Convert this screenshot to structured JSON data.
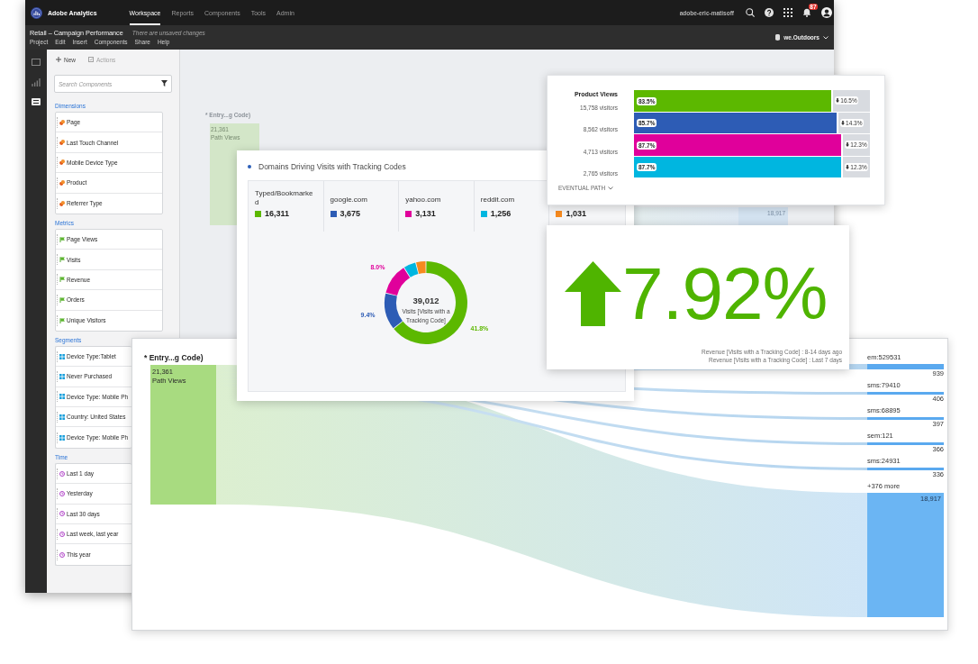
{
  "app": {
    "name": "Adobe Analytics",
    "nav": [
      {
        "label": "Workspace",
        "selected": true
      },
      {
        "label": "Reports",
        "selected": false
      },
      {
        "label": "Components",
        "selected": false
      },
      {
        "label": "Tools",
        "selected": false
      },
      {
        "label": "Admin",
        "selected": false
      }
    ],
    "user": "adobe-eric-matisoff",
    "notifications": "87"
  },
  "project": {
    "title": "Retail – Campaign Performance",
    "status": "There are unsaved changes",
    "menu": [
      "Project",
      "Edit",
      "Insert",
      "Components",
      "Share",
      "Help"
    ],
    "report_suite": "we.Outdoors"
  },
  "rail": [
    {
      "kind": "panels",
      "selected": false
    },
    {
      "kind": "visualizations",
      "selected": false
    },
    {
      "kind": "components",
      "selected": true
    }
  ],
  "sidebar": {
    "actions": [
      {
        "kind": "new",
        "label": "New",
        "disabled": false
      },
      {
        "kind": "actions",
        "label": "Actions",
        "disabled": true
      }
    ],
    "search": {
      "placeholder": "Search Components"
    },
    "sections": [
      {
        "title": "Dimensions",
        "kind": "dimension",
        "items": [
          "Page",
          "Last Touch Channel",
          "Mobile Device Type",
          "Product",
          "Referrer Type"
        ]
      },
      {
        "title": "Metrics",
        "kind": "metric",
        "items": [
          "Page Views",
          "Visits",
          "Revenue",
          "Orders",
          "Unique Visitors"
        ]
      },
      {
        "title": "Segments",
        "kind": "segment",
        "items": [
          "Device Type:Tablet",
          "Never Purchased",
          "Device Type: Mobile Ph",
          "Country: United States",
          "Device Type: Mobile Ph"
        ]
      },
      {
        "title": "Time",
        "kind": "time",
        "items": [
          "Last 1 day",
          "Yesterday",
          "Last 30 days",
          "Last week, last year",
          "This year"
        ]
      }
    ]
  },
  "background_panel": {
    "title": "* Entry...g Code)",
    "value": "21,361",
    "label": "Path Views",
    "node_value": "18,917"
  },
  "product_views": {
    "steps": [
      {
        "name": "Product Views",
        "visitors": "15,758 visitors",
        "percent": "83.5%",
        "drop": "16.5%",
        "color": "#5cb800",
        "level": 0.835
      },
      {
        "visitors": "8,562 visitors",
        "percent": "85.7%",
        "drop": "14.3%",
        "color": "#2d5cb5",
        "level": 0.857
      },
      {
        "visitors": "4,713 visitors",
        "percent": "87.7%",
        "drop": "12.3%",
        "color": "#e0009b",
        "level": 0.877
      },
      {
        "visitors": "2,765 visitors",
        "percent": "87.7%",
        "drop": "12.3%",
        "color": "#00b6e0",
        "level": 0.877
      }
    ],
    "path_type": "EVENTUAL PATH"
  },
  "domains": {
    "title": "Domains Driving Visits with Tracking Codes",
    "columns": [
      {
        "label": "Typed/Bookmarked",
        "value": "16,311",
        "color": "#5cb800"
      },
      {
        "label": "google.com",
        "value": "3,675",
        "color": "#2d5cb5"
      },
      {
        "label": "yahoo.com",
        "value": "3,131",
        "color": "#e0009b"
      },
      {
        "label": "reddit.com",
        "value": "1,256",
        "color": "#00b6e0"
      },
      {
        "value": "1,031",
        "color": "#f68a1f"
      }
    ],
    "donut": {
      "total": "39,012",
      "caption": "Visits [Visits with a Tracking Code]",
      "chart_data": {
        "type": "donut",
        "values": [
          41.8,
          9.4,
          8.0,
          3.2,
          2.6
        ],
        "value_labels": [
          "41.8%",
          "9.4%",
          "8.0%",
          null,
          null
        ]
      }
    }
  },
  "kpi": {
    "rising": true,
    "value": "7.92%",
    "notes": [
      "Revenue [Visits with a Tracking Code] : 8-14 days ago",
      "Revenue [Visits with a Tracking Code] : Last 7 days"
    ]
  },
  "flow": {
    "title": "* Entry...g Code)",
    "entry": {
      "value": "21,361",
      "label": "Path Views"
    },
    "targets": [
      {
        "label": "em:529531",
        "value": "939"
      },
      {
        "label": "sms:79410",
        "value": "406"
      },
      {
        "label": "sms:68895",
        "value": "397"
      },
      {
        "label": "sem:121",
        "value": "366"
      },
      {
        "label": "sms:24931",
        "value": "336"
      }
    ],
    "more": {
      "label": "+376 more",
      "value": "18,917"
    }
  }
}
